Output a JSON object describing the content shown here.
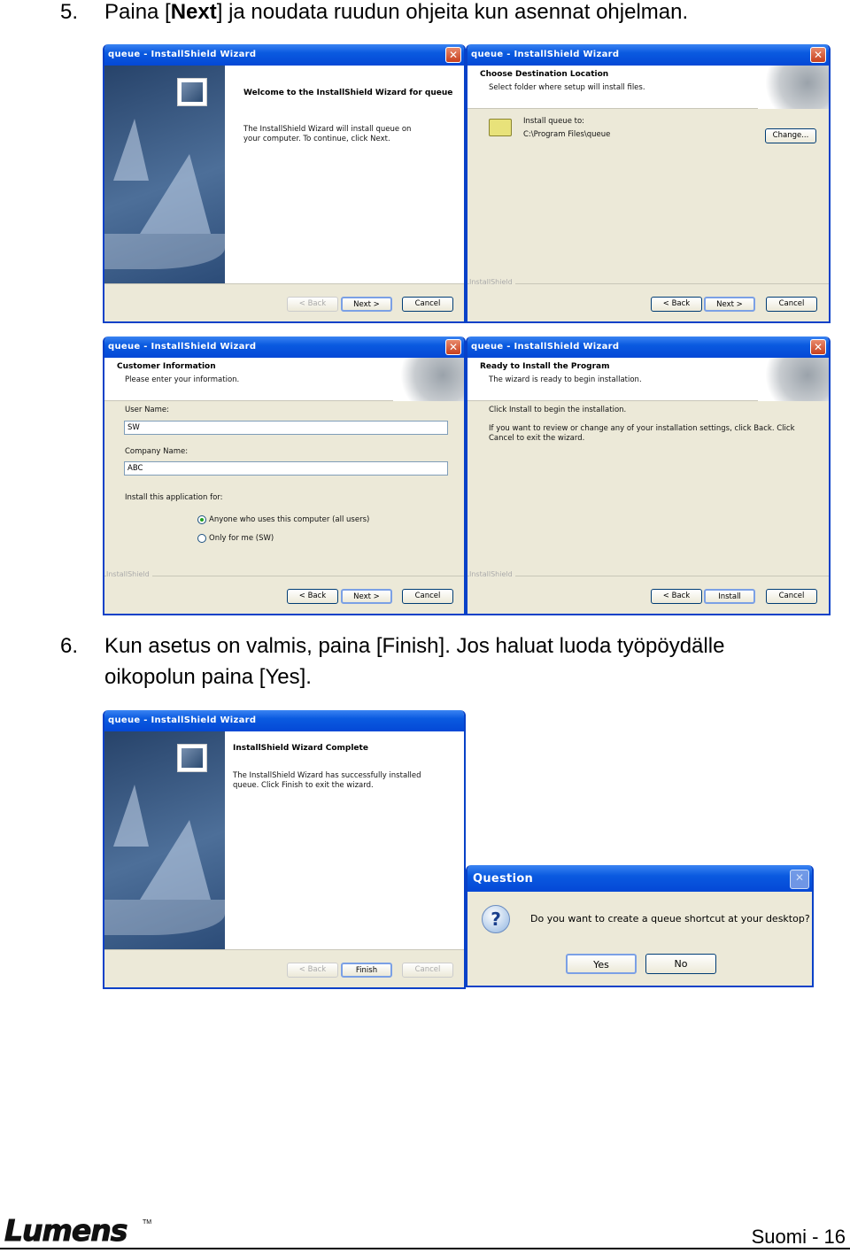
{
  "step5": {
    "number": "5.",
    "text_before": "Paina [",
    "text_bold": "Next",
    "text_after": "] ja noudata ruudun ohjeita kun asennat ohjelman."
  },
  "step6": {
    "number": "6.",
    "text": "Kun asetus on valmis, paina [Finish]. Jos haluat luoda työpöydälle oikopolun paina [Yes]."
  },
  "window_title": "queue - InstallShield Wizard",
  "close_glyph": "✕",
  "installshield_label": "InstallShield",
  "welcome": {
    "heading": "Welcome to the InstallShield Wizard for queue",
    "body": "The InstallShield Wizard will install queue on your computer.  To continue, click Next.",
    "buttons": {
      "back": "< Back",
      "next": "Next >",
      "cancel": "Cancel"
    }
  },
  "destination": {
    "heading": "Choose Destination Location",
    "subheading": "Select folder where setup will install files.",
    "install_to_label": "Install queue to:",
    "path": "C:\\Program Files\\queue",
    "change_button": "Change...",
    "buttons": {
      "back": "< Back",
      "next": "Next >",
      "cancel": "Cancel"
    }
  },
  "customer": {
    "heading": "Customer Information",
    "subheading": "Please enter your information.",
    "user_name_label": "User Name:",
    "user_name_value": "SW",
    "company_name_label": "Company Name:",
    "company_name_value": "ABC",
    "install_for_label": "Install this application for:",
    "options": [
      {
        "label": "Anyone who uses this computer (all users)",
        "selected": true
      },
      {
        "label": "Only for me (SW)",
        "selected": false
      }
    ],
    "buttons": {
      "back": "< Back",
      "next": "Next >",
      "cancel": "Cancel"
    }
  },
  "ready": {
    "heading": "Ready to Install the Program",
    "subheading": "The wizard is ready to begin installation.",
    "line1": "Click Install to begin the installation.",
    "line2": "If you want to review or change any of your installation settings, click Back. Click Cancel to exit the wizard.",
    "buttons": {
      "back": "< Back",
      "install": "Install",
      "cancel": "Cancel"
    }
  },
  "complete": {
    "heading": "InstallShield Wizard Complete",
    "body": "The InstallShield Wizard has successfully installed queue. Click Finish to exit the wizard.",
    "buttons": {
      "back": "< Back",
      "finish": "Finish",
      "cancel": "Cancel"
    }
  },
  "question": {
    "title": "Question",
    "icon": "question-icon",
    "icon_glyph": "?",
    "message": "Do you want to create a queue shortcut at your desktop?",
    "yes": "Yes",
    "no": "No"
  },
  "footer": {
    "brand": "Lumens",
    "trademark": "TM",
    "page": "Suomi - 16"
  },
  "colors": {
    "titlebar": "#0a5ae0",
    "dialog_bg": "#ece9d8",
    "close_red": "#c7401e"
  }
}
